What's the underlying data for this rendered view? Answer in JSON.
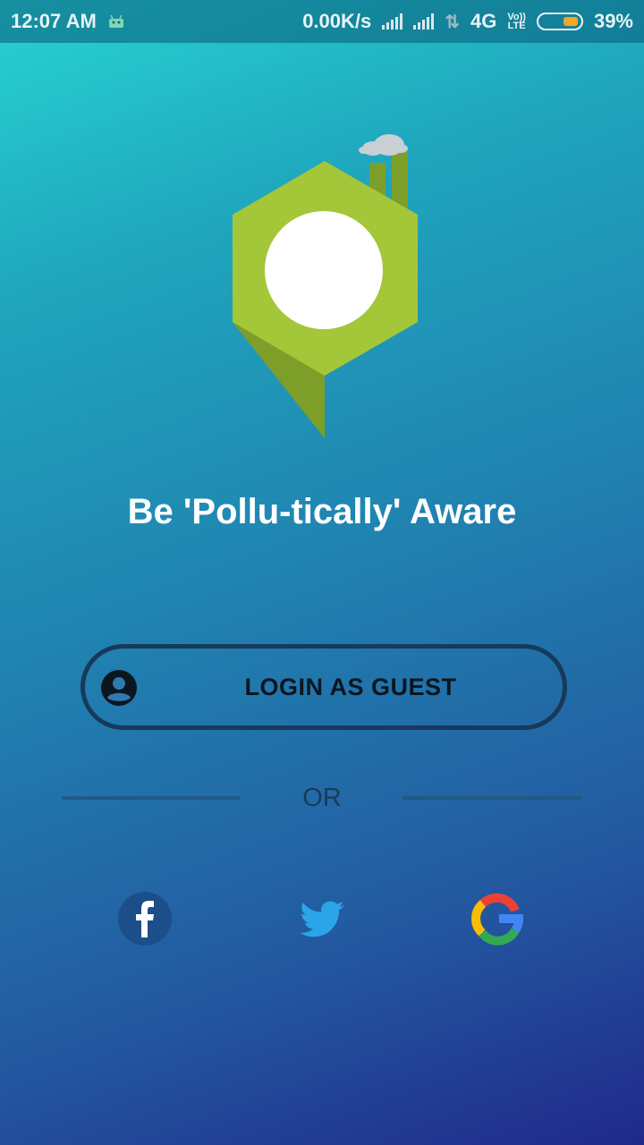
{
  "status_bar": {
    "time": "12:07 AM",
    "network_speed": "0.00K/s",
    "network_type": "4G",
    "volte_top": "Vo))",
    "volte_bottom": "LTE",
    "battery": "39%",
    "battery_color": "#f5a623"
  },
  "logo": {
    "name": "pollution-pin-logo",
    "accent": "#a4c639",
    "shade": "#7e9e2a"
  },
  "tagline": "Be 'Pollu-tically' Aware",
  "guest_button": {
    "label": "LOGIN AS GUEST",
    "icon": "account-circle-icon"
  },
  "divider_text": "OR",
  "social": [
    {
      "name": "facebook",
      "icon": "facebook-icon",
      "color": "#1c4e8a"
    },
    {
      "name": "twitter",
      "icon": "twitter-icon",
      "color": "#2aa6e8"
    },
    {
      "name": "google",
      "icon": "google-icon",
      "color": "#4285f4"
    }
  ]
}
